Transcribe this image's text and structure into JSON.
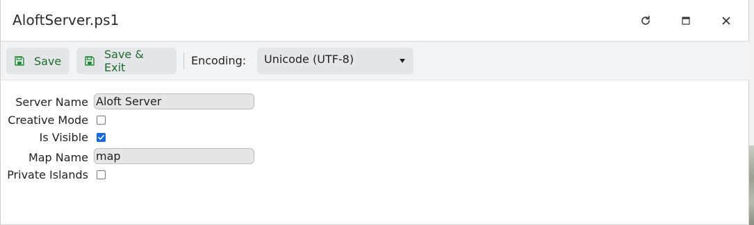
{
  "window": {
    "title": "AloftServer.ps1",
    "controls": [
      "refresh-icon",
      "maximize-icon",
      "close-icon"
    ]
  },
  "toolbar": {
    "save_label": "Save",
    "save_exit_label": "Save & Exit",
    "encoding_label": "Encoding:",
    "encoding_value": "Unicode (UTF-8)",
    "icon": "floppy-disk-icon",
    "accent_color": "#1f8a2e"
  },
  "form": {
    "server_name": {
      "label": "Server Name",
      "value": "Aloft Server"
    },
    "creative_mode": {
      "label": "Creative Mode",
      "checked": false
    },
    "is_visible": {
      "label": "Is Visible",
      "checked": true
    },
    "map_name": {
      "label": "Map Name",
      "value": "map"
    },
    "private_islands": {
      "label": "Private Islands",
      "checked": false
    }
  }
}
